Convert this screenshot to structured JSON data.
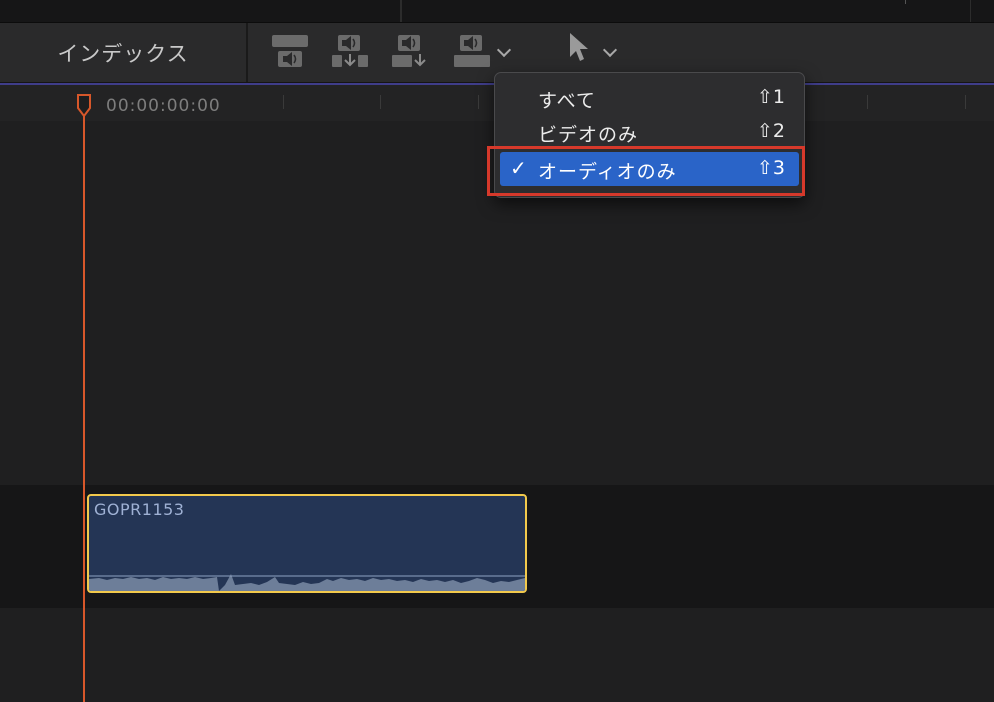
{
  "toolbar": {
    "index_label": "インデックス"
  },
  "ruler": {
    "timecode": "00:00:00:00"
  },
  "clip": {
    "name": "GOPR1153"
  },
  "dropdown": {
    "items": [
      {
        "label": "すべて",
        "shortcut": "⇧1",
        "checked": false
      },
      {
        "label": "ビデオのみ",
        "shortcut": "⇧2",
        "checked": false
      },
      {
        "label": "オーディオのみ",
        "shortcut": "⇧3",
        "checked": true
      }
    ],
    "check_glyph": "✓"
  },
  "icons": [
    "clip-appearance-audio-icon",
    "audio-waveform-down-icon",
    "audio-lane-down-icon",
    "audio-clip-icon",
    "select-arrow-tool-icon"
  ],
  "colors": {
    "playhead": "#d7572a",
    "clip_border": "#f2c94c",
    "clip_fill": "#243555",
    "menu_selected": "#2a64c8",
    "annotation_box": "#d6392b"
  }
}
